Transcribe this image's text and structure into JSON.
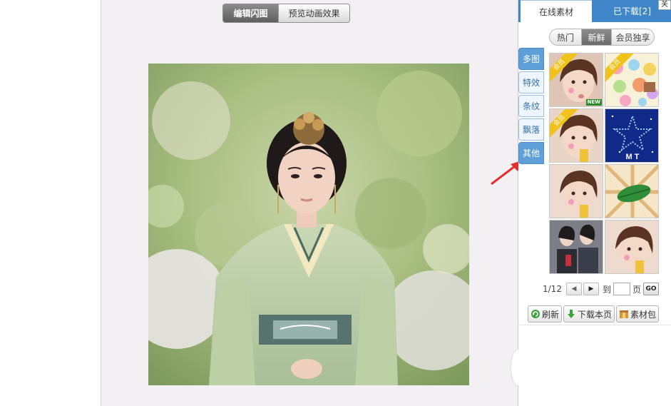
{
  "editor": {
    "mode_tabs": [
      {
        "label": "编辑闪图",
        "active": true
      },
      {
        "label": "预览动画效果",
        "active": false
      }
    ]
  },
  "panel": {
    "tabs": [
      {
        "label": "在线素材",
        "active": true
      },
      {
        "label": "已下载[2]",
        "active": false
      }
    ],
    "corner_label": "关",
    "filters": [
      {
        "label": "热门",
        "selected": false
      },
      {
        "label": "新鲜",
        "selected": true
      },
      {
        "label": "会员独享",
        "selected": false
      }
    ],
    "categories": [
      {
        "label": "多图",
        "active": true
      },
      {
        "label": "特效",
        "active": false
      },
      {
        "label": "条纹",
        "active": false
      },
      {
        "label": "飘落",
        "active": false
      },
      {
        "label": "其他",
        "active": true
      }
    ],
    "thumbnails": [
      {
        "icon": "girl-photo-thumbnail",
        "badge": "会员",
        "new_badge": "NEW"
      },
      {
        "icon": "cartoon-collage-thumbnail",
        "badge": "会员",
        "new_badge": ""
      },
      {
        "icon": "girl-photo-thumbnail",
        "badge": "会员",
        "new_badge": ""
      },
      {
        "icon": "star-mt-thumbnail",
        "badge": "",
        "new_badge": "",
        "text": "M T"
      },
      {
        "icon": "girl-photo-thumbnail",
        "badge": "",
        "new_badge": ""
      },
      {
        "icon": "leaf-sunburst-thumbnail",
        "badge": "",
        "new_badge": ""
      },
      {
        "icon": "two-girls-thumbnail",
        "badge": "",
        "new_badge": ""
      },
      {
        "icon": "girl-photo-thumbnail",
        "badge": "",
        "new_badge": ""
      }
    ],
    "pager": {
      "current": "1/12",
      "goto_label": "到",
      "page_unit": "页",
      "input_value": "",
      "go_label": "GO"
    },
    "actions": [
      {
        "label": "刷新",
        "icon": "refresh-icon"
      },
      {
        "label": "下载本页",
        "icon": "download-icon"
      },
      {
        "label": "素材包",
        "icon": "package-icon"
      }
    ]
  },
  "colors": {
    "accent": "#3e86c7",
    "side_tab_active": "#5e9fd8",
    "arrow": "#e52d2d",
    "badge_yellow": "#f1c21a"
  }
}
